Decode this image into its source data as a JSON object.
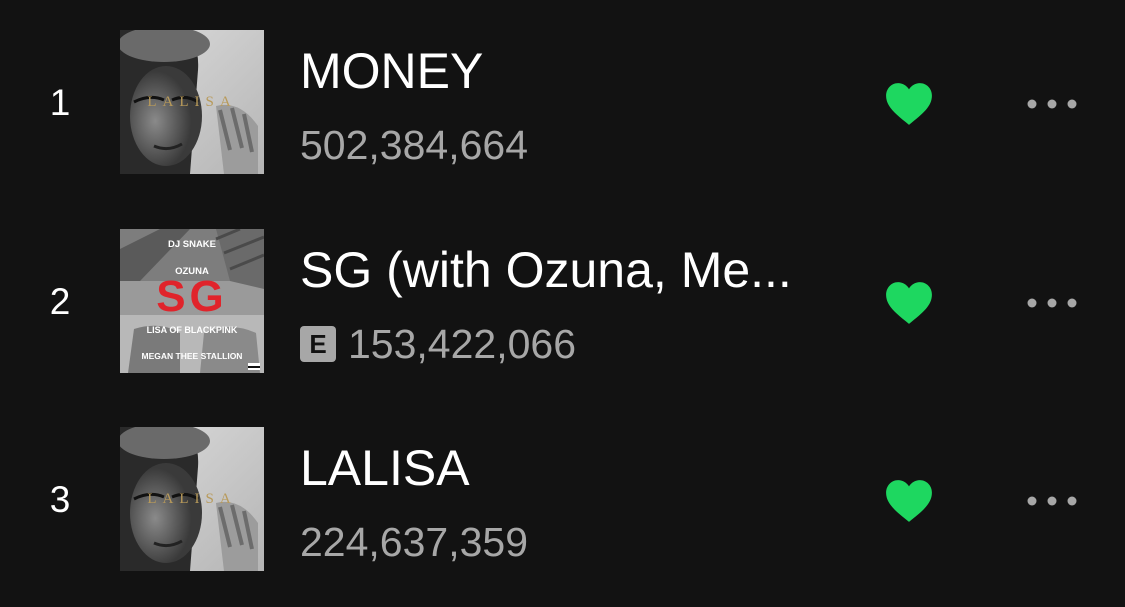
{
  "colors": {
    "background": "#121212",
    "text_primary": "#ffffff",
    "text_secondary": "#a7a7a7",
    "liked_heart": "#1ed760"
  },
  "tracks": [
    {
      "rank": "1",
      "title": "MONEY",
      "plays": "502,384,664",
      "explicit": false,
      "liked": true,
      "album_art": {
        "style": "grayscale-portrait",
        "cover_text": "LALISA"
      },
      "like_icon": "heart-filled-icon",
      "more_icon": "more-options-icon"
    },
    {
      "rank": "2",
      "title": "SG (with Ozuna, Me...",
      "plays": "153,422,066",
      "explicit": true,
      "explicit_label": "E",
      "liked": true,
      "album_art": {
        "style": "sg-collage",
        "cover_text_1": "DJ SNAKE",
        "cover_text_2": "OZUNA",
        "cover_logo": "SG",
        "cover_text_3": "LISA OF BLACKPINK",
        "cover_text_4": "MEGAN THEE STALLION"
      },
      "like_icon": "heart-filled-icon",
      "more_icon": "more-options-icon"
    },
    {
      "rank": "3",
      "title": "LALISA",
      "plays": "224,637,359",
      "explicit": false,
      "liked": true,
      "album_art": {
        "style": "grayscale-portrait",
        "cover_text": "LALISA"
      },
      "like_icon": "heart-filled-icon",
      "more_icon": "more-options-icon"
    }
  ]
}
